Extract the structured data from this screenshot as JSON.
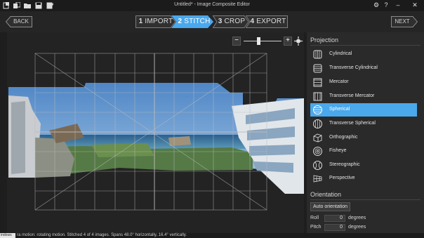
{
  "window": {
    "title": "Untitled* - Image Composite Editor",
    "gear": "⚙",
    "help": "?",
    "minimize": "–",
    "close": "✕"
  },
  "nav": {
    "back_label": "BACK",
    "next_label": "NEXT"
  },
  "steps": [
    {
      "num": "1",
      "label": "IMPORT",
      "active": false
    },
    {
      "num": "2",
      "label": "STITCH",
      "active": true
    },
    {
      "num": "3",
      "label": "CROP",
      "active": false
    },
    {
      "num": "4",
      "label": "EXPORT",
      "active": false
    }
  ],
  "canvas_toolbar": {
    "zoom_out": "−",
    "zoom_in": "+"
  },
  "projection": {
    "heading": "Projection",
    "items": [
      {
        "label": "Cylindrical",
        "icon": "cylinder-icon"
      },
      {
        "label": "Transverse Cylindrical",
        "icon": "transverse-cylinder-icon"
      },
      {
        "label": "Mercator",
        "icon": "mercator-icon"
      },
      {
        "label": "Transverse Mercator",
        "icon": "transverse-mercator-icon"
      },
      {
        "label": "Spherical",
        "icon": "sphere-icon",
        "selected": true
      },
      {
        "label": "Transverse Spherical",
        "icon": "transverse-sphere-icon"
      },
      {
        "label": "Orthographic",
        "icon": "cube-icon"
      },
      {
        "label": "Fisheye",
        "icon": "fisheye-icon"
      },
      {
        "label": "Stereographic",
        "icon": "stereographic-icon"
      },
      {
        "label": "Perspective",
        "icon": "perspective-icon"
      }
    ]
  },
  "orientation": {
    "heading": "Orientation",
    "auto_button": "Auto orientation",
    "roll_label": "Roll",
    "roll_value": "0",
    "pitch_label": "Pitch",
    "pitch_value": "0",
    "unit": "degrees"
  },
  "status": {
    "tag": "indows",
    "text": "ra motion: rotating motion. Stitched 4 of 4 images. Spans 48.0° horizontally, 16.4° vertically."
  },
  "colors": {
    "accent": "#4aa8ec",
    "background": "#1e1e1e",
    "panel": "#2a2a2a"
  }
}
